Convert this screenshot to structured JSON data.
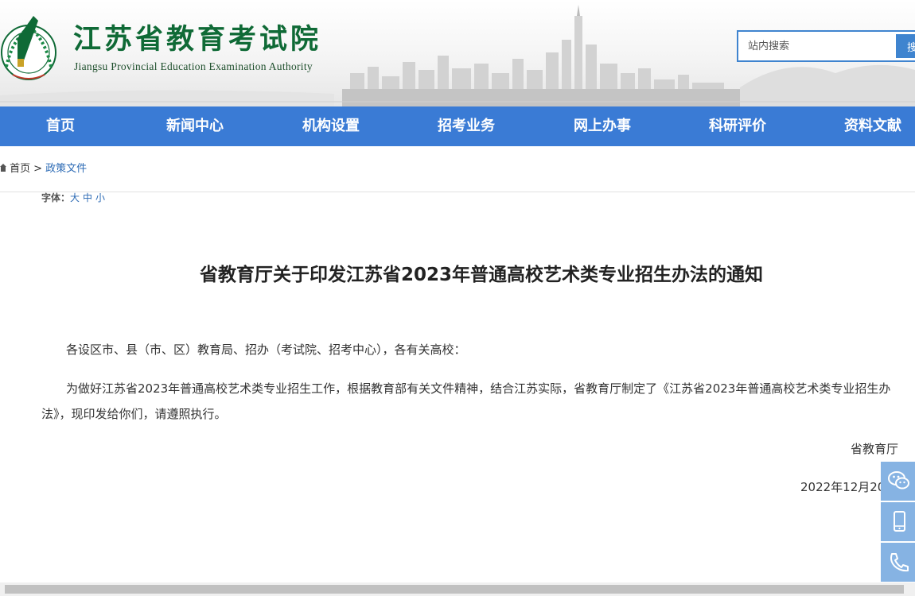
{
  "header": {
    "title_cn": "江苏省教育考试院",
    "title_en": "Jiangsu Provincial Education Examination Authority",
    "search_placeholder": "站内搜索",
    "search_button": "搜"
  },
  "nav": {
    "items": [
      "首页",
      "新闻中心",
      "机构设置",
      "招考业务",
      "网上办事",
      "科研评价",
      "资料文献"
    ]
  },
  "breadcrumb": {
    "home": "首页",
    "separator": ">",
    "current": "政策文件"
  },
  "font_size": {
    "label": "字体：",
    "options": [
      "大",
      "中",
      "小"
    ]
  },
  "article": {
    "title": "省教育厅关于印发江苏省2023年普通高校艺术类专业招生办法的通知",
    "paragraphs": [
      "各设区市、县（市、区）教育局、招办（考试院、招考中心），各有关高校：",
      "为做好江苏省2023年普通高校艺术类专业招生工作，根据教育部有关文件精神，结合江苏实际，省教育厅制定了《江苏省2023年普通高校艺术类专业招生办法》，现印发给你们，请遵照执行。"
    ],
    "signature": "省教育厅",
    "date": "2022年12月20"
  },
  "side_tools": {
    "icons": [
      "wechat-icon",
      "mobile-icon",
      "phone-icon"
    ]
  },
  "colors": {
    "nav_bg": "#3a7bd5",
    "brand_green": "#0f6a36",
    "link_blue": "#2d6bb5",
    "side_btn": "#86b3e3"
  }
}
